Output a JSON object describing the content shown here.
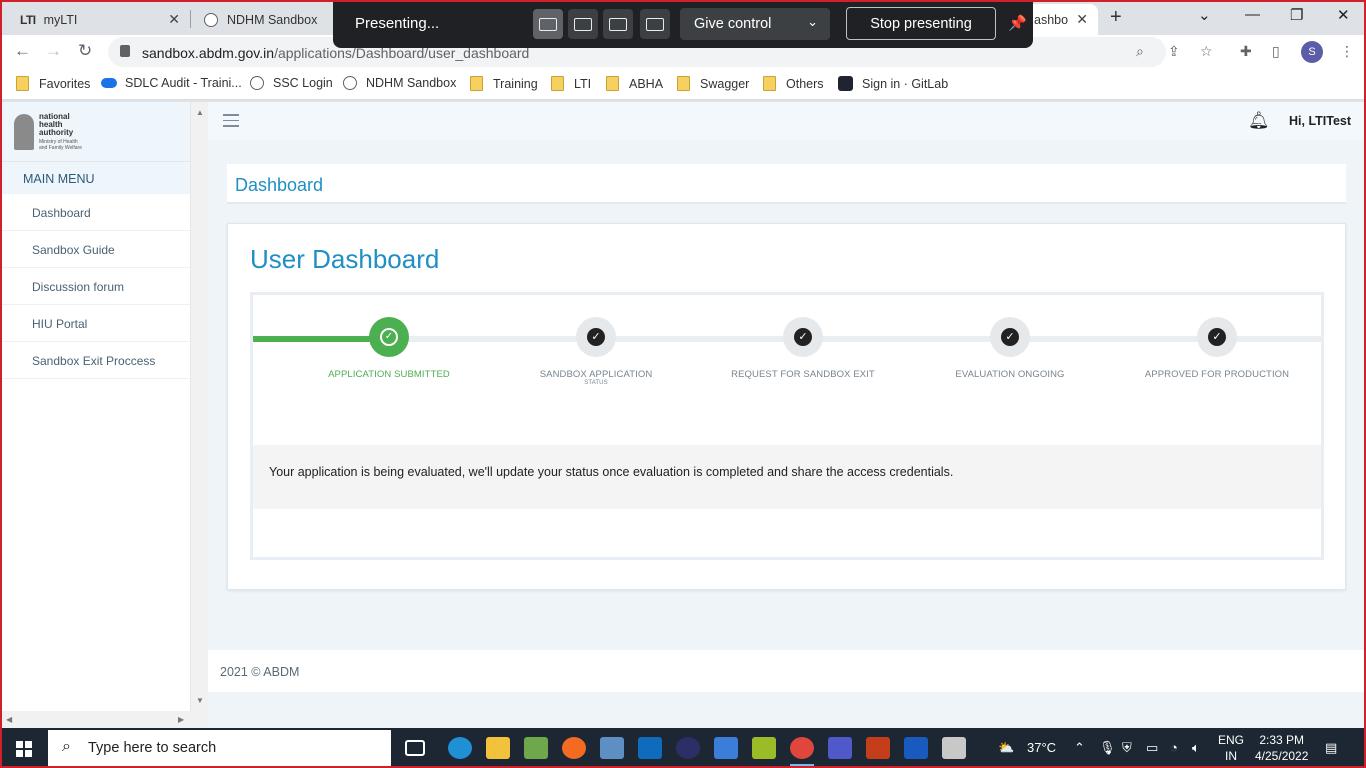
{
  "browser": {
    "tabs": [
      {
        "label": "myLTI",
        "favicon": "LTI"
      },
      {
        "label": "NDHM Sandbox"
      },
      {
        "label": "ashbo"
      }
    ],
    "url_host": "sandbox.abdm.gov.in",
    "url_path": "/applications/Dashboard/user_dashboard",
    "profile_initial": "S",
    "bookmarks": [
      "Favorites",
      "SDLC Audit - Traini...",
      "SSC Login",
      "NDHM Sandbox",
      "Training",
      "LTI",
      "ABHA",
      "Swagger",
      "Others",
      "Sign in · GitLab"
    ]
  },
  "presenting": {
    "label": "Presenting...",
    "give_control": "Give control",
    "stop": "Stop presenting"
  },
  "sidebar": {
    "logo_lines": [
      "national",
      "health",
      "authority"
    ],
    "logo_sub": "Ministry of Health and Family Welfare",
    "menu_title": "MAIN MENU",
    "items": [
      "Dashboard",
      "Sandbox Guide",
      "Discussion forum",
      "HIU Portal",
      "Sandbox Exit Proccess"
    ]
  },
  "header": {
    "greeting": "Hi, LTITest"
  },
  "page": {
    "breadcrumb_title": "Dashboard",
    "card_title": "User Dashboard",
    "progress_fraction": 0.13,
    "steps": [
      {
        "label": "APPLICATION SUBMITTED",
        "sub": "",
        "done": true
      },
      {
        "label": "SANDBOX APPLICATION",
        "sub": "STATUS",
        "done": false
      },
      {
        "label": "REQUEST FOR SANDBOX EXIT",
        "sub": "",
        "done": false
      },
      {
        "label": "EVALUATION ONGOING",
        "sub": "",
        "done": false
      },
      {
        "label": "APPROVED FOR PRODUCTION",
        "sub": "",
        "done": false
      }
    ],
    "status_message": "Your application is being evaluated, we'll update your status once evaluation is completed and share the access credentials."
  },
  "footer": {
    "text": "2021 © ABDM"
  },
  "taskbar": {
    "search_placeholder": "Type here to search",
    "weather": "37°C",
    "lang_top": "ENG",
    "lang_bottom": "IN",
    "time": "2:33 PM",
    "date": "4/25/2022"
  },
  "colors": {
    "accent": "#1f8fc4",
    "success": "#4caf50",
    "present_bar": "#202124",
    "taskbar": "#1c2733"
  }
}
